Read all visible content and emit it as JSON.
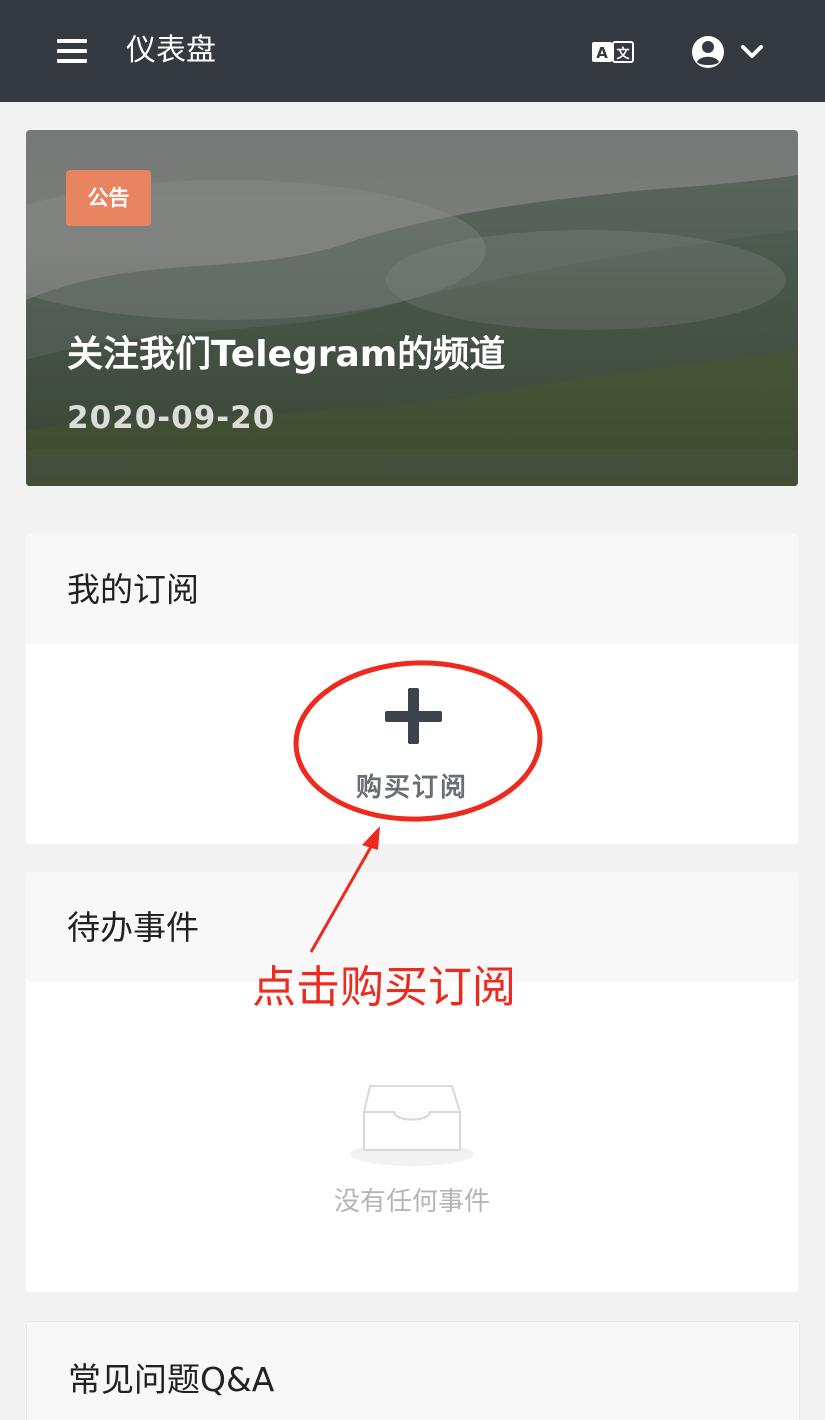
{
  "header": {
    "title": "仪表盘",
    "menu_icon": "hamburger-menu-icon",
    "language_icon": "translate-icon",
    "user_icon": "user-circle-icon",
    "dropdown_icon": "chevron-down-icon"
  },
  "announcement": {
    "badge": "公告",
    "title": "关注我们Telegram的频道",
    "date": "2020-09-20"
  },
  "subscription": {
    "title": "我的订阅",
    "buy_label": "购买订阅"
  },
  "todo": {
    "title": "待办事件",
    "empty_text": "没有任何事件"
  },
  "faq": {
    "title": "常见问题Q&A"
  },
  "annotation": {
    "text": "点击购买订阅"
  },
  "colors": {
    "header_bg": "#343a40",
    "badge_bg": "#e98461",
    "annotation_red": "#ee2a1e"
  }
}
